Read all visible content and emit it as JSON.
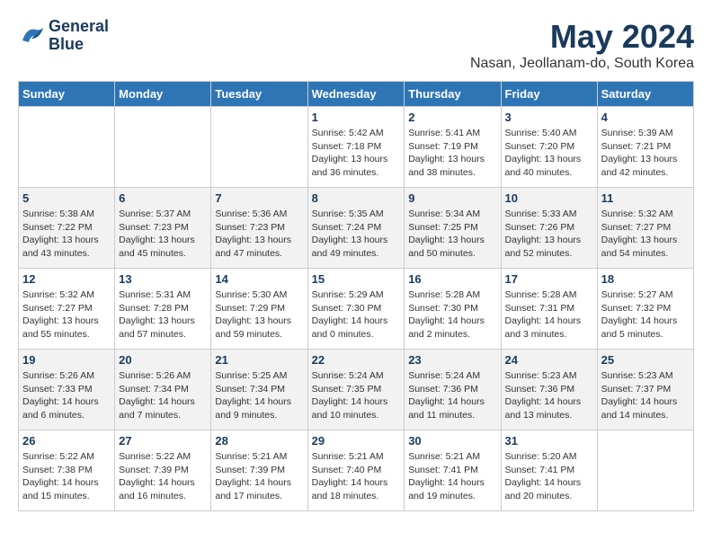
{
  "header": {
    "logo": {
      "line1": "General",
      "line2": "Blue"
    },
    "title": "May 2024",
    "location": "Nasan, Jeollanam-do, South Korea"
  },
  "weekdays": [
    "Sunday",
    "Monday",
    "Tuesday",
    "Wednesday",
    "Thursday",
    "Friday",
    "Saturday"
  ],
  "weeks": [
    [
      {
        "day": "",
        "info": ""
      },
      {
        "day": "",
        "info": ""
      },
      {
        "day": "",
        "info": ""
      },
      {
        "day": "1",
        "info": "Sunrise: 5:42 AM\nSunset: 7:18 PM\nDaylight: 13 hours\nand 36 minutes."
      },
      {
        "day": "2",
        "info": "Sunrise: 5:41 AM\nSunset: 7:19 PM\nDaylight: 13 hours\nand 38 minutes."
      },
      {
        "day": "3",
        "info": "Sunrise: 5:40 AM\nSunset: 7:20 PM\nDaylight: 13 hours\nand 40 minutes."
      },
      {
        "day": "4",
        "info": "Sunrise: 5:39 AM\nSunset: 7:21 PM\nDaylight: 13 hours\nand 42 minutes."
      }
    ],
    [
      {
        "day": "5",
        "info": "Sunrise: 5:38 AM\nSunset: 7:22 PM\nDaylight: 13 hours\nand 43 minutes."
      },
      {
        "day": "6",
        "info": "Sunrise: 5:37 AM\nSunset: 7:23 PM\nDaylight: 13 hours\nand 45 minutes."
      },
      {
        "day": "7",
        "info": "Sunrise: 5:36 AM\nSunset: 7:23 PM\nDaylight: 13 hours\nand 47 minutes."
      },
      {
        "day": "8",
        "info": "Sunrise: 5:35 AM\nSunset: 7:24 PM\nDaylight: 13 hours\nand 49 minutes."
      },
      {
        "day": "9",
        "info": "Sunrise: 5:34 AM\nSunset: 7:25 PM\nDaylight: 13 hours\nand 50 minutes."
      },
      {
        "day": "10",
        "info": "Sunrise: 5:33 AM\nSunset: 7:26 PM\nDaylight: 13 hours\nand 52 minutes."
      },
      {
        "day": "11",
        "info": "Sunrise: 5:32 AM\nSunset: 7:27 PM\nDaylight: 13 hours\nand 54 minutes."
      }
    ],
    [
      {
        "day": "12",
        "info": "Sunrise: 5:32 AM\nSunset: 7:27 PM\nDaylight: 13 hours\nand 55 minutes."
      },
      {
        "day": "13",
        "info": "Sunrise: 5:31 AM\nSunset: 7:28 PM\nDaylight: 13 hours\nand 57 minutes."
      },
      {
        "day": "14",
        "info": "Sunrise: 5:30 AM\nSunset: 7:29 PM\nDaylight: 13 hours\nand 59 minutes."
      },
      {
        "day": "15",
        "info": "Sunrise: 5:29 AM\nSunset: 7:30 PM\nDaylight: 14 hours\nand 0 minutes."
      },
      {
        "day": "16",
        "info": "Sunrise: 5:28 AM\nSunset: 7:30 PM\nDaylight: 14 hours\nand 2 minutes."
      },
      {
        "day": "17",
        "info": "Sunrise: 5:28 AM\nSunset: 7:31 PM\nDaylight: 14 hours\nand 3 minutes."
      },
      {
        "day": "18",
        "info": "Sunrise: 5:27 AM\nSunset: 7:32 PM\nDaylight: 14 hours\nand 5 minutes."
      }
    ],
    [
      {
        "day": "19",
        "info": "Sunrise: 5:26 AM\nSunset: 7:33 PM\nDaylight: 14 hours\nand 6 minutes."
      },
      {
        "day": "20",
        "info": "Sunrise: 5:26 AM\nSunset: 7:34 PM\nDaylight: 14 hours\nand 7 minutes."
      },
      {
        "day": "21",
        "info": "Sunrise: 5:25 AM\nSunset: 7:34 PM\nDaylight: 14 hours\nand 9 minutes."
      },
      {
        "day": "22",
        "info": "Sunrise: 5:24 AM\nSunset: 7:35 PM\nDaylight: 14 hours\nand 10 minutes."
      },
      {
        "day": "23",
        "info": "Sunrise: 5:24 AM\nSunset: 7:36 PM\nDaylight: 14 hours\nand 11 minutes."
      },
      {
        "day": "24",
        "info": "Sunrise: 5:23 AM\nSunset: 7:36 PM\nDaylight: 14 hours\nand 13 minutes."
      },
      {
        "day": "25",
        "info": "Sunrise: 5:23 AM\nSunset: 7:37 PM\nDaylight: 14 hours\nand 14 minutes."
      }
    ],
    [
      {
        "day": "26",
        "info": "Sunrise: 5:22 AM\nSunset: 7:38 PM\nDaylight: 14 hours\nand 15 minutes."
      },
      {
        "day": "27",
        "info": "Sunrise: 5:22 AM\nSunset: 7:39 PM\nDaylight: 14 hours\nand 16 minutes."
      },
      {
        "day": "28",
        "info": "Sunrise: 5:21 AM\nSunset: 7:39 PM\nDaylight: 14 hours\nand 17 minutes."
      },
      {
        "day": "29",
        "info": "Sunrise: 5:21 AM\nSunset: 7:40 PM\nDaylight: 14 hours\nand 18 minutes."
      },
      {
        "day": "30",
        "info": "Sunrise: 5:21 AM\nSunset: 7:41 PM\nDaylight: 14 hours\nand 19 minutes."
      },
      {
        "day": "31",
        "info": "Sunrise: 5:20 AM\nSunset: 7:41 PM\nDaylight: 14 hours\nand 20 minutes."
      },
      {
        "day": "",
        "info": ""
      }
    ]
  ]
}
